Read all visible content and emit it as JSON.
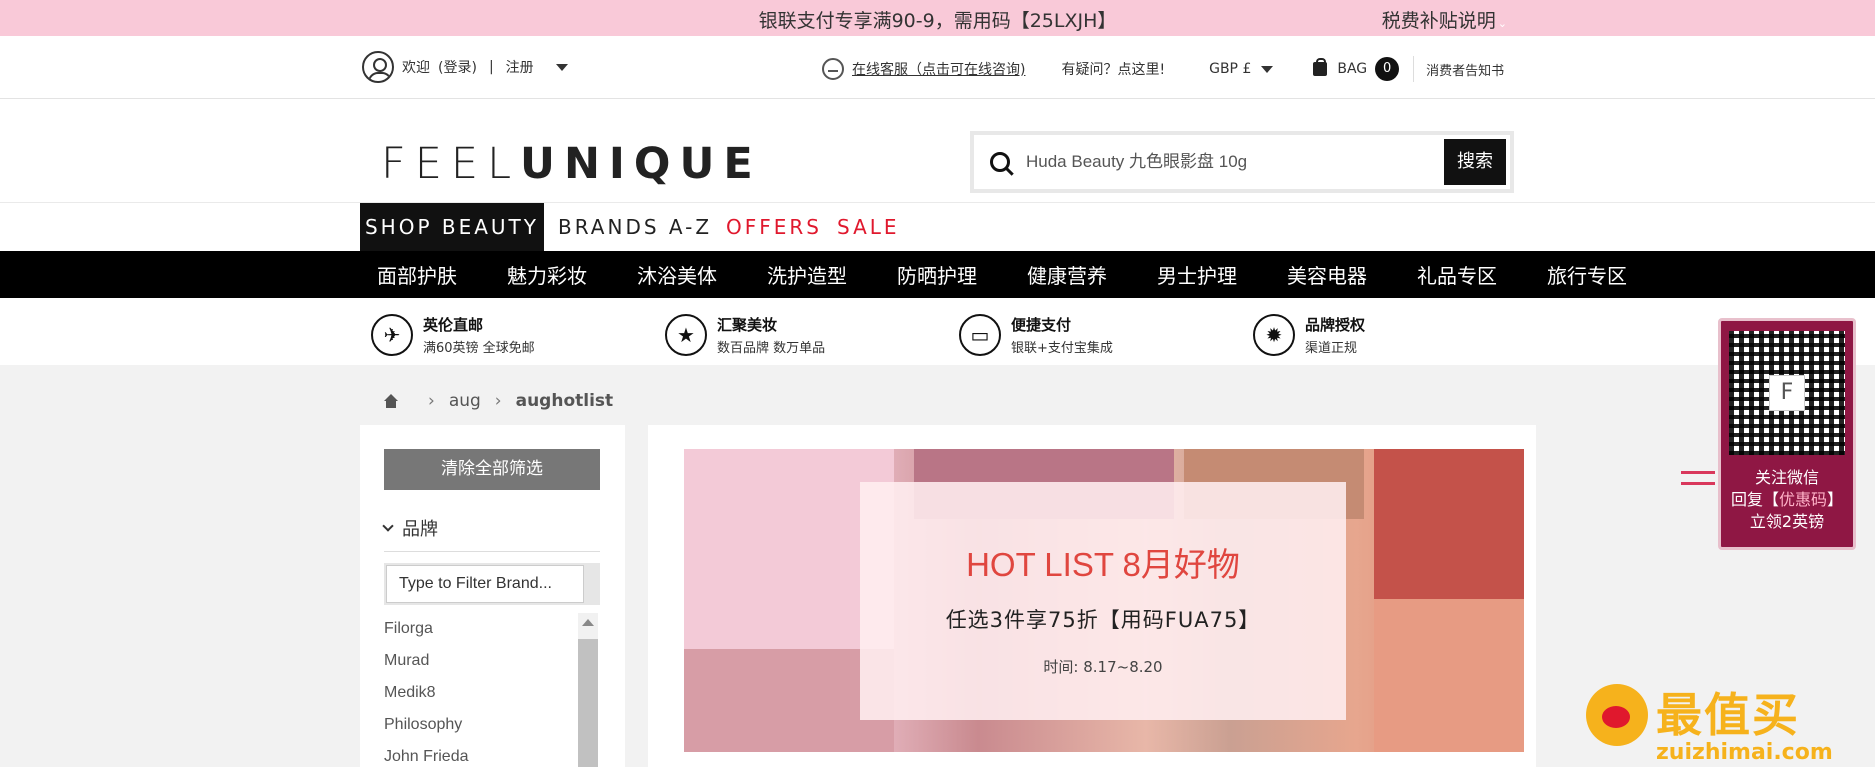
{
  "topbar": {
    "promo": "银联支付专享满90-9，需用码【25LXJH】",
    "tax": "税费补贴说明"
  },
  "util": {
    "welcome": "欢迎",
    "login": "(登录)",
    "sep": "|",
    "register": "注册",
    "support": "在线客服（点击可在线咨询)",
    "faq": "有疑问？点这里!",
    "currency": "GBP £",
    "bag": "BAG",
    "bag_count": "0",
    "notice": "消费者告知书"
  },
  "header": {
    "logo_light": "FEEL",
    "logo_bold": "UNIQUE",
    "search_placeholder": "Huda Beauty 九色眼影盘 10g",
    "search_button": "搜索"
  },
  "tabs": [
    "SHOP BEAUTY",
    "BRANDS A-Z",
    "OFFERS",
    "SALE"
  ],
  "categories": [
    "面部护肤",
    "魅力彩妆",
    "沐浴美体",
    "洗护造型",
    "防晒护理",
    "健康营养",
    "男士护理",
    "美容电器",
    "礼品专区",
    "旅行专区"
  ],
  "usp": [
    {
      "title": "英伦直邮",
      "sub": "满60英镑 全球免邮",
      "icon": "plane-icon"
    },
    {
      "title": "汇聚美妆",
      "sub": "数百品牌 数万单品",
      "icon": "star-icon"
    },
    {
      "title": "便捷支付",
      "sub": "银联+支付宝集成",
      "icon": "card-icon"
    },
    {
      "title": "品牌授权",
      "sub": "渠道正规",
      "icon": "badge-icon"
    }
  ],
  "breadcrumb": {
    "level1": "aug",
    "current": "aughotlist"
  },
  "sidebar": {
    "clear_all": "清除全部筛选",
    "brand_heading": "品牌",
    "filter_placeholder": "Type to Filter Brand...",
    "brands": [
      "Filorga",
      "Murad",
      "Medik8",
      "Philosophy",
      "John Frieda"
    ]
  },
  "banner": {
    "headline": "HOT LIST 8月好物",
    "offer": "任选3件享75折【用码FUA75】",
    "dates": "时间: 8.17~8.20"
  },
  "qr": {
    "center_letter": "F",
    "line1": "关注微信",
    "line2_pre": "回复【",
    "line2_hl": "优惠码",
    "line2_post": "】",
    "line3": "立领2英镑"
  },
  "watermark": {
    "cn": "最值买",
    "en": "zuizhimai.com"
  }
}
